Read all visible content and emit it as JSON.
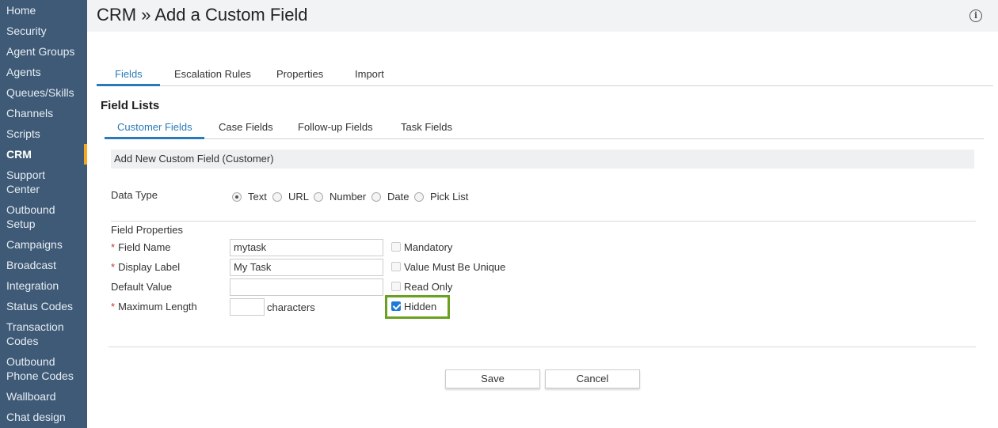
{
  "sidebar": {
    "items": [
      {
        "label": "Home"
      },
      {
        "label": "Security"
      },
      {
        "label": "Agent Groups"
      },
      {
        "label": "Agents"
      },
      {
        "label": "Queues/Skills"
      },
      {
        "label": "Channels"
      },
      {
        "label": "Scripts"
      },
      {
        "label": "CRM",
        "active": true
      },
      {
        "label": "Support\nCenter"
      },
      {
        "label": "Outbound\nSetup"
      },
      {
        "label": "Campaigns"
      },
      {
        "label": "Broadcast"
      },
      {
        "label": "Integration"
      },
      {
        "label": "Status Codes"
      },
      {
        "label": "Transaction\nCodes"
      },
      {
        "label": "Outbound\nPhone Codes"
      },
      {
        "label": "Wallboard"
      },
      {
        "label": "Chat design"
      }
    ]
  },
  "header": {
    "title": "CRM » Add a Custom Field",
    "info_icon": "info-icon"
  },
  "main_tabs": {
    "items": [
      "Fields",
      "Escalation Rules",
      "Properties",
      "Import"
    ],
    "active": "Fields"
  },
  "field_lists": {
    "heading": "Field Lists",
    "tabs": [
      "Customer Fields",
      "Case Fields",
      "Follow-up Fields",
      "Task Fields"
    ],
    "active": "Customer Fields"
  },
  "panel": {
    "title": "Add New Custom Field (Customer)"
  },
  "data_type": {
    "label": "Data Type",
    "options": [
      "Text",
      "URL",
      "Number",
      "Date",
      "Pick List"
    ],
    "selected": "Text"
  },
  "field_properties": {
    "heading": "Field Properties",
    "required_marker": "*",
    "field_name": {
      "label": "Field Name",
      "value": "mytask",
      "required": true
    },
    "display_label": {
      "label": "Display Label",
      "value": "My Task",
      "required": true
    },
    "default_value": {
      "label": "Default Value",
      "value": ""
    },
    "max_length": {
      "label": "Maximum Length",
      "value": "",
      "unit": "characters",
      "required": true
    },
    "checkboxes": [
      {
        "label": "Mandatory",
        "checked": false
      },
      {
        "label": "Value Must Be Unique",
        "checked": false
      },
      {
        "label": "Read Only",
        "checked": false
      },
      {
        "label": "Hidden",
        "checked": true
      }
    ],
    "highlight_color": "#6aa121"
  },
  "buttons": {
    "save": "Save",
    "cancel": "Cancel"
  },
  "colors": {
    "sidebar_bg": "#3f5a76",
    "accent": "#2a7ab8",
    "active_marker": "#f5a623"
  }
}
